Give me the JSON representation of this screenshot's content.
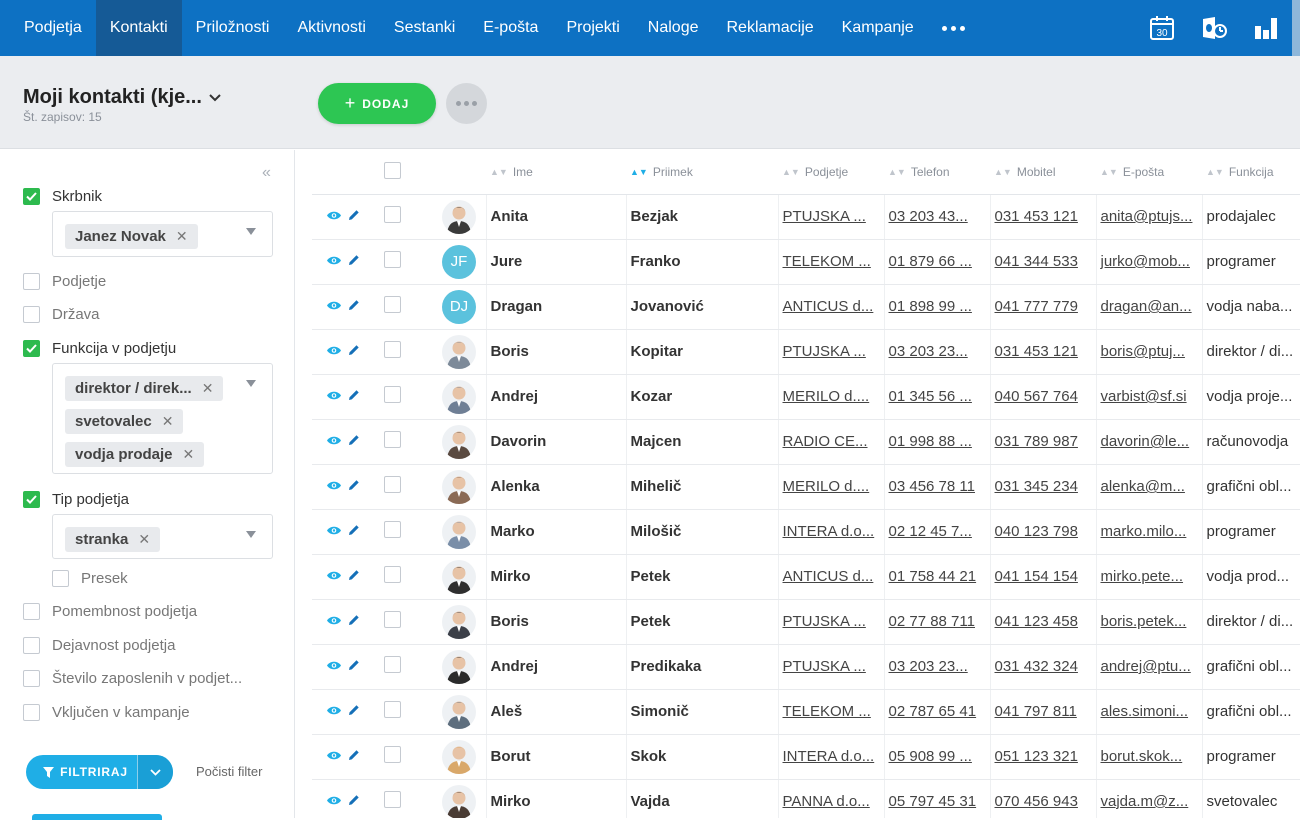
{
  "nav": {
    "items": [
      {
        "label": "Podjetja",
        "active": false
      },
      {
        "label": "Kontakti",
        "active": true
      },
      {
        "label": "Priložnosti",
        "active": false
      },
      {
        "label": "Aktivnosti",
        "active": false
      },
      {
        "label": "Sestanki",
        "active": false
      },
      {
        "label": "E-pošta",
        "active": false
      },
      {
        "label": "Projekti",
        "active": false
      },
      {
        "label": "Naloge",
        "active": false
      },
      {
        "label": "Reklamacije",
        "active": false
      },
      {
        "label": "Kampanje",
        "active": false
      }
    ],
    "calendar_day": "30",
    "icons": [
      "more-icon",
      "calendar-icon",
      "outlook-sync-icon",
      "reports-chart-icon"
    ]
  },
  "header": {
    "view_title": "Moji kontakti (kje...",
    "record_count": "Št. zapisov: 15",
    "add_label": "DODAJ"
  },
  "filters": {
    "skrbnik": {
      "label": "Skrbnik",
      "checked": true,
      "tags": [
        "Janez Novak"
      ]
    },
    "podjetje": {
      "label": "Podjetje",
      "checked": false
    },
    "drzava": {
      "label": "Država",
      "checked": false
    },
    "funkcija": {
      "label": "Funkcija v podjetju",
      "checked": true,
      "tags": [
        "direktor / direk...",
        "svetovalec",
        "vodja prodaje"
      ]
    },
    "tip": {
      "label": "Tip podjetja",
      "checked": true,
      "tags": [
        "stranka"
      ]
    },
    "presek": {
      "label": "Presek",
      "checked": false
    },
    "pomembnost": {
      "label": "Pomembnost podjetja",
      "checked": false
    },
    "dejavnost": {
      "label": "Dejavnost podjetja",
      "checked": false
    },
    "zaposleni": {
      "label": "Število zaposlenih v podjet...",
      "checked": false
    },
    "kampanje": {
      "label": "Vključen v kampanje",
      "checked": false
    },
    "filter_button": "FILTRIRAJ",
    "clear_filter": "Počisti filter"
  },
  "table": {
    "columns": [
      "Ime",
      "Priimek",
      "Podjetje",
      "Telefon",
      "Mobitel",
      "E-pošta",
      "Funkcija"
    ],
    "sorted_column": "Priimek",
    "rows": [
      {
        "avatar": "photo",
        "avatar_color": "#3a3a3a",
        "ime": "Anita",
        "priimek": "Bezjak",
        "podjetje": "PTUJSKA ...",
        "telefon": "03 203 43...",
        "mobitel": "031 453 121",
        "email": "anita@ptujs...",
        "funkcija": "prodajalec"
      },
      {
        "avatar": "JF",
        "avatar_color": "#5bc2dd",
        "ime": "Jure",
        "priimek": "Franko",
        "podjetje": "TELEKOM ...",
        "telefon": "01 879 66 ...",
        "mobitel": "041 344 533",
        "email": "jurko@mob...",
        "funkcija": "programer"
      },
      {
        "avatar": "DJ",
        "avatar_color": "#5bc2dd",
        "ime": "Dragan",
        "priimek": "Jovanović",
        "podjetje": "ANTICUS d...",
        "telefon": "01 898 99 ...",
        "mobitel": "041 777 779",
        "email": "dragan@an...",
        "funkcija": "vodja naba..."
      },
      {
        "avatar": "photo",
        "avatar_color": "#7d8a99",
        "ime": "Boris",
        "priimek": "Kopitar",
        "podjetje": "PTUJSKA ...",
        "telefon": "03 203 23...",
        "mobitel": "031 453 121",
        "email": "boris@ptuj...",
        "funkcija": "direktor / di..."
      },
      {
        "avatar": "photo",
        "avatar_color": "#6f7f95",
        "ime": "Andrej",
        "priimek": "Kozar",
        "podjetje": "MERILO d....",
        "telefon": "01 345 56 ...",
        "mobitel": "040 567 764",
        "email": "varbist@sf.si",
        "funkcija": "vodja proje..."
      },
      {
        "avatar": "photo",
        "avatar_color": "#5a4a40",
        "ime": "Davorin",
        "priimek": "Majcen",
        "podjetje": "RADIO CE...",
        "telefon": "01 998 88 ...",
        "mobitel": "031 789 987",
        "email": "davorin@le...",
        "funkcija": "računovodja"
      },
      {
        "avatar": "photo",
        "avatar_color": "#8a6a55",
        "ime": "Alenka",
        "priimek": "Mihelič",
        "podjetje": "MERILO d....",
        "telefon": "03 456 78 11",
        "mobitel": "031 345 234",
        "email": "alenka@m...",
        "funkcija": "grafični obl..."
      },
      {
        "avatar": "photo",
        "avatar_color": "#7a8ea8",
        "ime": "Marko",
        "priimek": "Milošič",
        "podjetje": "INTERA d.o...",
        "telefon": "02 12 45 7...",
        "mobitel": "040 123 798",
        "email": "marko.milo...",
        "funkcija": "programer"
      },
      {
        "avatar": "photo",
        "avatar_color": "#2f2f2f",
        "ime": "Mirko",
        "priimek": "Petek",
        "podjetje": "ANTICUS d...",
        "telefon": "01 758 44 21",
        "mobitel": "041 154 154",
        "email": "mirko.pete...",
        "funkcija": "vodja prod..."
      },
      {
        "avatar": "photo",
        "avatar_color": "#3b3f48",
        "ime": "Boris",
        "priimek": "Petek",
        "podjetje": "PTUJSKA ...",
        "telefon": "02 77 88 711",
        "mobitel": "041 123 458",
        "email": "boris.petek...",
        "funkcija": "direktor / di..."
      },
      {
        "avatar": "photo",
        "avatar_color": "#2b2b2b",
        "ime": "Andrej",
        "priimek": "Predikaka",
        "podjetje": "PTUJSKA ...",
        "telefon": "03 203 23...",
        "mobitel": "031 432 324",
        "email": "andrej@ptu...",
        "funkcija": "grafični obl..."
      },
      {
        "avatar": "photo",
        "avatar_color": "#5e6e7e",
        "ime": "Aleš",
        "priimek": "Simonič",
        "podjetje": "TELEKOM ...",
        "telefon": "02 787 65 41",
        "mobitel": "041 797 811",
        "email": "ales.simoni...",
        "funkcija": "grafični obl..."
      },
      {
        "avatar": "photo",
        "avatar_color": "#d9a86a",
        "ime": "Borut",
        "priimek": "Skok",
        "podjetje": "INTERA d.o...",
        "telefon": "05 908 99 ...",
        "mobitel": "051 123 321",
        "email": "borut.skok...",
        "funkcija": "programer"
      },
      {
        "avatar": "photo",
        "avatar_color": "#4a3c34",
        "ime": "Mirko",
        "priimek": "Vajda",
        "podjetje": "PANNA d.o...",
        "telefon": "05 797 45 31",
        "mobitel": "070 456 943",
        "email": "vajda.m@z...",
        "funkcija": "svetovalec"
      }
    ]
  }
}
